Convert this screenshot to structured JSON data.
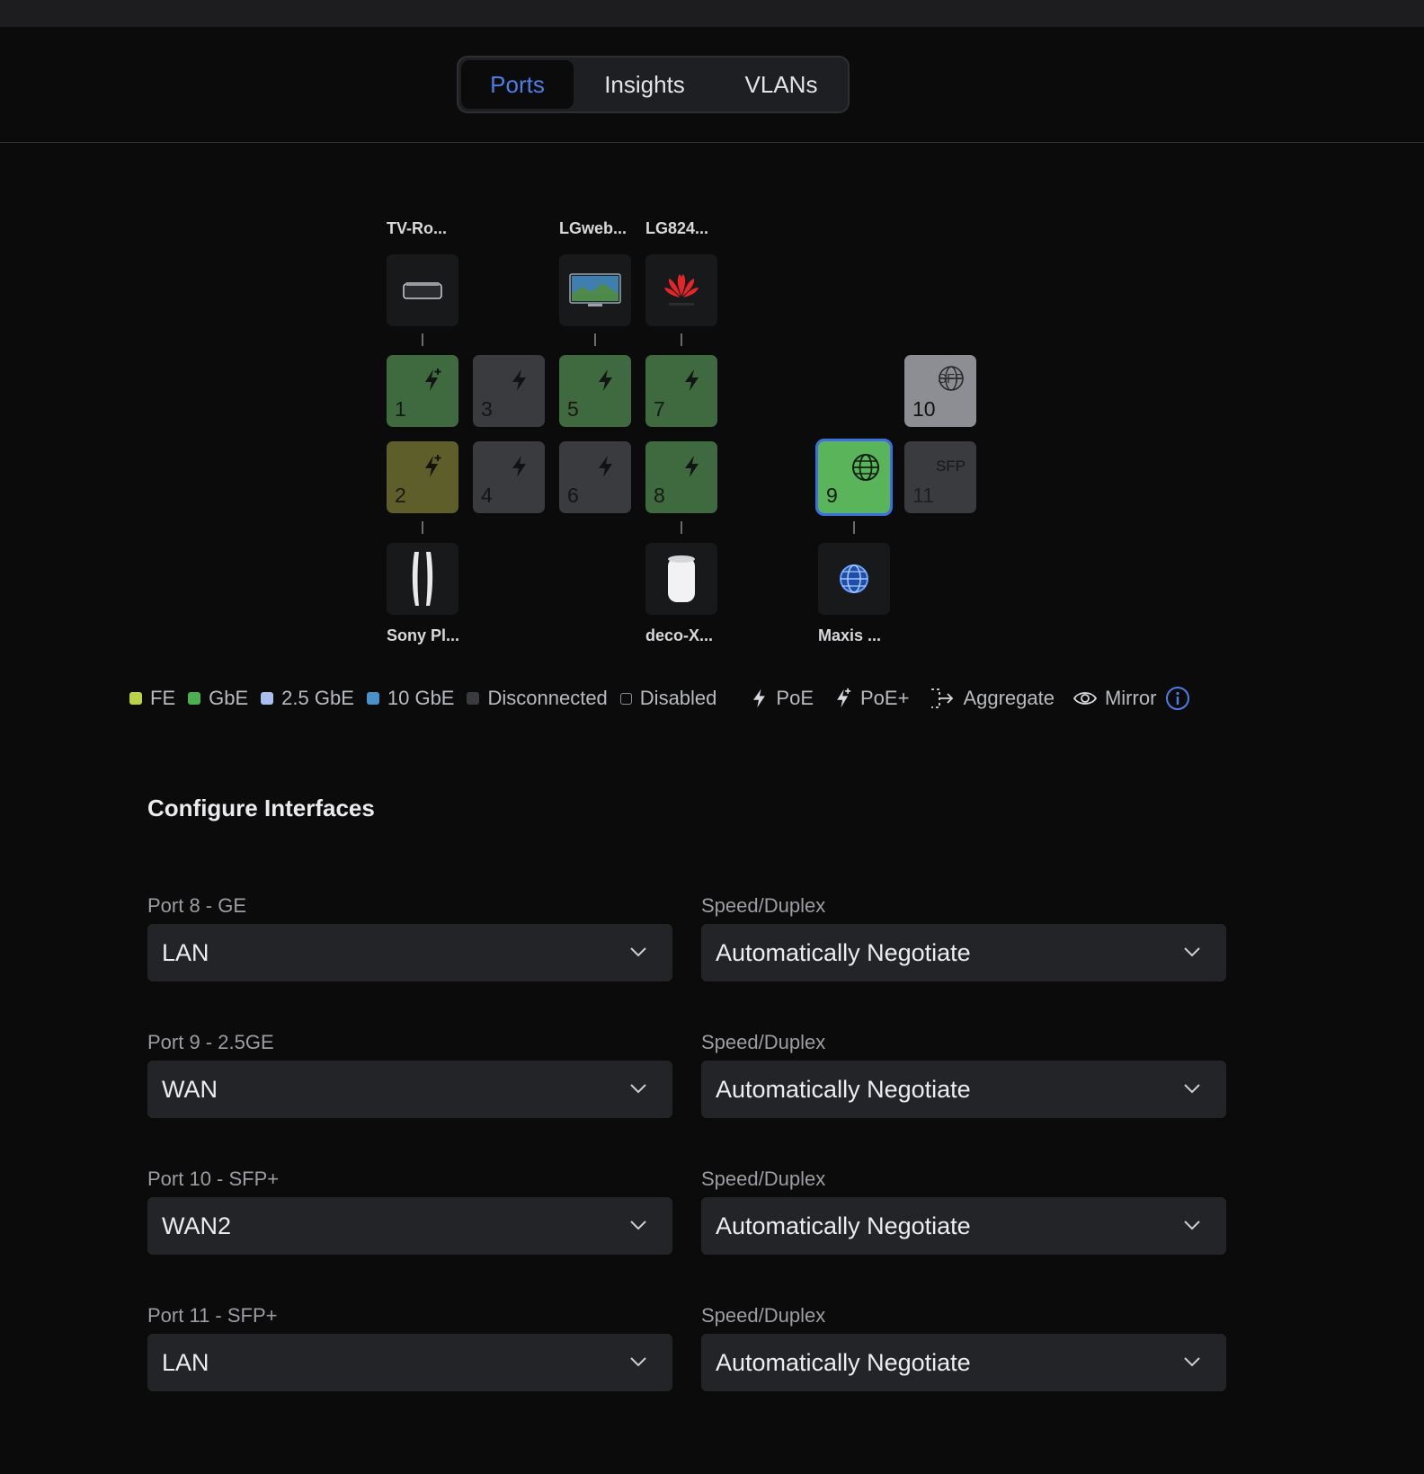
{
  "tabs": [
    {
      "label": "Ports",
      "active": true
    },
    {
      "label": "Insights",
      "active": false
    },
    {
      "label": "VLANs",
      "active": false
    }
  ],
  "devices": {
    "top": [
      {
        "label": "TV-Ro...",
        "icon": "apple-tv-icon",
        "port": "1"
      },
      {
        "label": "LGweb...",
        "icon": "tv-icon",
        "port": "5"
      },
      {
        "label": "LG824...",
        "icon": "huawei-logo-icon",
        "port": "7"
      }
    ],
    "bottom": [
      {
        "label": "Sony Pl...",
        "icon": "playstation-icon",
        "port": "2"
      },
      {
        "label": "deco-X...",
        "icon": "deco-router-icon",
        "port": "8"
      },
      {
        "label": "Maxis ...",
        "icon": "globe-icon",
        "port": "9"
      }
    ]
  },
  "ports": [
    {
      "num": "1",
      "status": "GbE",
      "power": "PoE+",
      "color": "#3f6a3f"
    },
    {
      "num": "2",
      "status": "FE",
      "power": "PoE+",
      "color": "#5d5e2a"
    },
    {
      "num": "3",
      "status": "Disconnected",
      "power": "PoE",
      "color": "#3a3b3f"
    },
    {
      "num": "4",
      "status": "Disconnected",
      "power": "PoE",
      "color": "#3a3b3f"
    },
    {
      "num": "5",
      "status": "GbE",
      "power": "PoE",
      "color": "#3f6a3f"
    },
    {
      "num": "6",
      "status": "Disconnected",
      "power": "PoE",
      "color": "#3a3b3f"
    },
    {
      "num": "7",
      "status": "GbE",
      "power": "PoE",
      "color": "#3f6a3f"
    },
    {
      "num": "8",
      "status": "GbE",
      "power": "PoE",
      "color": "#3f6a3f"
    },
    {
      "num": "9",
      "status": "GbE",
      "role": "WAN",
      "color": "#5ab55a",
      "selected": true
    },
    {
      "num": "10",
      "status": "Disabled",
      "role": "WAN",
      "type": "SFP",
      "color": "#8d8e93"
    },
    {
      "num": "11",
      "status": "Disconnected",
      "type": "SFP",
      "color": "#3a3b3f"
    }
  ],
  "sfp_label": "SFP",
  "legend": [
    {
      "label": "FE",
      "color": "#b8d24a"
    },
    {
      "label": "GbE",
      "color": "#4caf50"
    },
    {
      "label": "2.5 GbE",
      "color": "#a8bff0"
    },
    {
      "label": "10 GbE",
      "color": "#4a90c9"
    },
    {
      "label": "Disconnected",
      "color": "#3a3b3f"
    },
    {
      "label": "Disabled",
      "color": "transparent"
    },
    {
      "label": "PoE",
      "icon": "bolt-icon"
    },
    {
      "label": "PoE+",
      "icon": "bolt-plus-icon"
    },
    {
      "label": "Aggregate",
      "icon": "aggregate-icon"
    },
    {
      "label": "Mirror",
      "icon": "eye-icon"
    }
  ],
  "section_title": "Configure Interfaces",
  "interfaces": [
    {
      "port_label": "Port 8 - GE",
      "network": "LAN",
      "speed_label": "Speed/Duplex",
      "speed": "Automatically Negotiate"
    },
    {
      "port_label": "Port 9 - 2.5GE",
      "network": "WAN",
      "speed_label": "Speed/Duplex",
      "speed": "Automatically Negotiate"
    },
    {
      "port_label": "Port 10 - SFP+",
      "network": "WAN2",
      "speed_label": "Speed/Duplex",
      "speed": "Automatically Negotiate"
    },
    {
      "port_label": "Port 11 - SFP+",
      "network": "LAN",
      "speed_label": "Speed/Duplex",
      "speed": "Automatically Negotiate"
    }
  ],
  "colors": {
    "accent": "#4b7fe6",
    "background": "#0b0b0c",
    "selected_outline": "#3c6fe0"
  }
}
